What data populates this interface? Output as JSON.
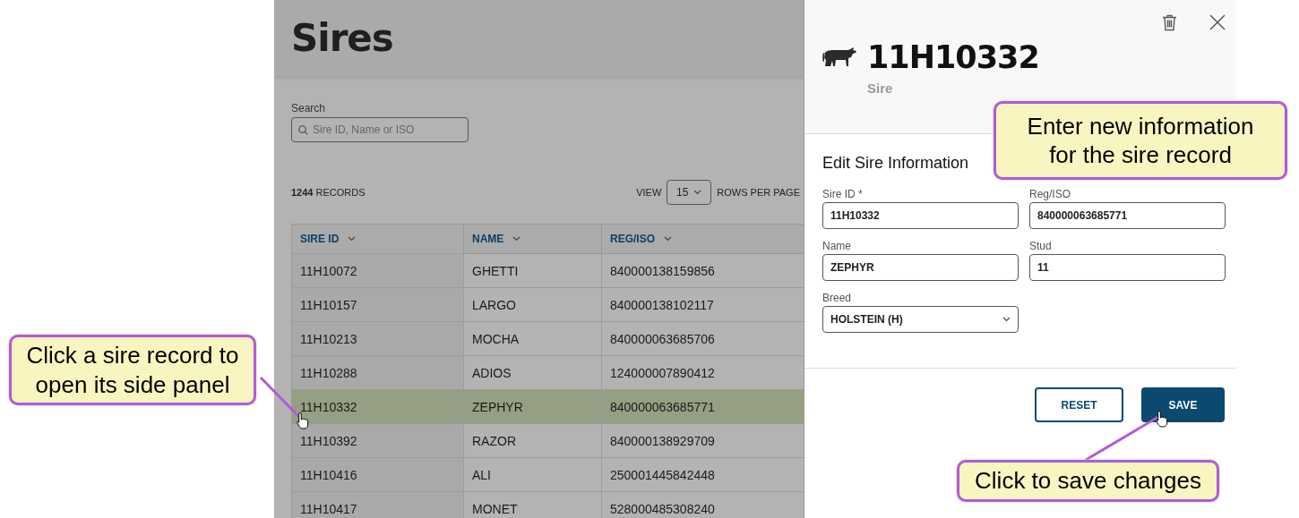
{
  "page": {
    "title": "Sires"
  },
  "search": {
    "label": "Search",
    "placeholder": "Sire ID, Name or ISO"
  },
  "records": "**1244** RECORDS",
  "view": {
    "label": "VIEW",
    "value": "15",
    "suffix": "ROWS PER PAGE"
  },
  "table": {
    "columns": [
      "SIRE ID",
      "NAME",
      "REG/ISO"
    ],
    "rows": [
      {
        "cells": [
          "11H10072",
          "GHETTI",
          "840000138159856"
        ],
        "selected": false
      },
      {
        "cells": [
          "11H10157",
          "LARGO",
          "840000138102117"
        ],
        "selected": false
      },
      {
        "cells": [
          "11H10213",
          "MOCHA",
          "840000063685706"
        ],
        "selected": false
      },
      {
        "cells": [
          "11H10288",
          "ADIOS",
          "124000007890412"
        ],
        "selected": false
      },
      {
        "cells": [
          "11H10332",
          "ZEPHYR",
          "840000063685771"
        ],
        "selected": true
      },
      {
        "cells": [
          "11H10392",
          "RAZOR",
          "840000138929709"
        ],
        "selected": false
      },
      {
        "cells": [
          "11H10416",
          "ALI",
          "250001445842448"
        ],
        "selected": false
      },
      {
        "cells": [
          "11H10417",
          "MONET",
          "528000485308240"
        ],
        "selected": false
      }
    ]
  },
  "panel": {
    "id": "11H10332",
    "subtitle": "Sire",
    "section_title": "Edit Sire Information",
    "fields": [
      {
        "label": "Sire ID *",
        "value": "11H10332",
        "kind": "text"
      },
      {
        "label": "Reg/ISO",
        "value": "840000063685771",
        "kind": "text"
      },
      {
        "label": "Name",
        "value": "ZEPHYR",
        "kind": "text"
      },
      {
        "label": "Stud",
        "value": "11",
        "kind": "text"
      },
      {
        "label": "Breed",
        "value": "HOLSTEIN (H)",
        "kind": "select"
      }
    ],
    "buttons": [
      {
        "label": "RESET",
        "kind": "secondary"
      },
      {
        "label": "SAVE",
        "kind": "primary"
      }
    ]
  },
  "callouts": [
    {
      "text": "Click a sire record to open its side panel"
    },
    {
      "text": "Enter new information for the sire record"
    },
    {
      "text": "Click to save changes"
    }
  ]
}
